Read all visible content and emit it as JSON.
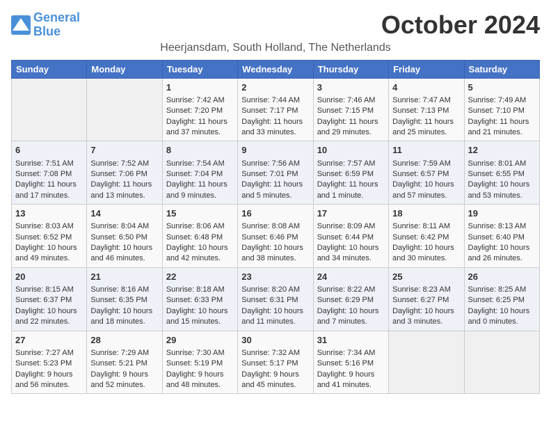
{
  "logo": {
    "line1": "General",
    "line2": "Blue"
  },
  "title": "October 2024",
  "location": "Heerjansdam, South Holland, The Netherlands",
  "days_header": [
    "Sunday",
    "Monday",
    "Tuesday",
    "Wednesday",
    "Thursday",
    "Friday",
    "Saturday"
  ],
  "weeks": [
    [
      {
        "day": "",
        "lines": []
      },
      {
        "day": "",
        "lines": []
      },
      {
        "day": "1",
        "lines": [
          "Sunrise: 7:42 AM",
          "Sunset: 7:20 PM",
          "Daylight: 11 hours and 37 minutes."
        ]
      },
      {
        "day": "2",
        "lines": [
          "Sunrise: 7:44 AM",
          "Sunset: 7:17 PM",
          "Daylight: 11 hours and 33 minutes."
        ]
      },
      {
        "day": "3",
        "lines": [
          "Sunrise: 7:46 AM",
          "Sunset: 7:15 PM",
          "Daylight: 11 hours and 29 minutes."
        ]
      },
      {
        "day": "4",
        "lines": [
          "Sunrise: 7:47 AM",
          "Sunset: 7:13 PM",
          "Daylight: 11 hours and 25 minutes."
        ]
      },
      {
        "day": "5",
        "lines": [
          "Sunrise: 7:49 AM",
          "Sunset: 7:10 PM",
          "Daylight: 11 hours and 21 minutes."
        ]
      }
    ],
    [
      {
        "day": "6",
        "lines": [
          "Sunrise: 7:51 AM",
          "Sunset: 7:08 PM",
          "Daylight: 11 hours and 17 minutes."
        ]
      },
      {
        "day": "7",
        "lines": [
          "Sunrise: 7:52 AM",
          "Sunset: 7:06 PM",
          "Daylight: 11 hours and 13 minutes."
        ]
      },
      {
        "day": "8",
        "lines": [
          "Sunrise: 7:54 AM",
          "Sunset: 7:04 PM",
          "Daylight: 11 hours and 9 minutes."
        ]
      },
      {
        "day": "9",
        "lines": [
          "Sunrise: 7:56 AM",
          "Sunset: 7:01 PM",
          "Daylight: 11 hours and 5 minutes."
        ]
      },
      {
        "day": "10",
        "lines": [
          "Sunrise: 7:57 AM",
          "Sunset: 6:59 PM",
          "Daylight: 11 hours and 1 minute."
        ]
      },
      {
        "day": "11",
        "lines": [
          "Sunrise: 7:59 AM",
          "Sunset: 6:57 PM",
          "Daylight: 10 hours and 57 minutes."
        ]
      },
      {
        "day": "12",
        "lines": [
          "Sunrise: 8:01 AM",
          "Sunset: 6:55 PM",
          "Daylight: 10 hours and 53 minutes."
        ]
      }
    ],
    [
      {
        "day": "13",
        "lines": [
          "Sunrise: 8:03 AM",
          "Sunset: 6:52 PM",
          "Daylight: 10 hours and 49 minutes."
        ]
      },
      {
        "day": "14",
        "lines": [
          "Sunrise: 8:04 AM",
          "Sunset: 6:50 PM",
          "Daylight: 10 hours and 46 minutes."
        ]
      },
      {
        "day": "15",
        "lines": [
          "Sunrise: 8:06 AM",
          "Sunset: 6:48 PM",
          "Daylight: 10 hours and 42 minutes."
        ]
      },
      {
        "day": "16",
        "lines": [
          "Sunrise: 8:08 AM",
          "Sunset: 6:46 PM",
          "Daylight: 10 hours and 38 minutes."
        ]
      },
      {
        "day": "17",
        "lines": [
          "Sunrise: 8:09 AM",
          "Sunset: 6:44 PM",
          "Daylight: 10 hours and 34 minutes."
        ]
      },
      {
        "day": "18",
        "lines": [
          "Sunrise: 8:11 AM",
          "Sunset: 6:42 PM",
          "Daylight: 10 hours and 30 minutes."
        ]
      },
      {
        "day": "19",
        "lines": [
          "Sunrise: 8:13 AM",
          "Sunset: 6:40 PM",
          "Daylight: 10 hours and 26 minutes."
        ]
      }
    ],
    [
      {
        "day": "20",
        "lines": [
          "Sunrise: 8:15 AM",
          "Sunset: 6:37 PM",
          "Daylight: 10 hours and 22 minutes."
        ]
      },
      {
        "day": "21",
        "lines": [
          "Sunrise: 8:16 AM",
          "Sunset: 6:35 PM",
          "Daylight: 10 hours and 18 minutes."
        ]
      },
      {
        "day": "22",
        "lines": [
          "Sunrise: 8:18 AM",
          "Sunset: 6:33 PM",
          "Daylight: 10 hours and 15 minutes."
        ]
      },
      {
        "day": "23",
        "lines": [
          "Sunrise: 8:20 AM",
          "Sunset: 6:31 PM",
          "Daylight: 10 hours and 11 minutes."
        ]
      },
      {
        "day": "24",
        "lines": [
          "Sunrise: 8:22 AM",
          "Sunset: 6:29 PM",
          "Daylight: 10 hours and 7 minutes."
        ]
      },
      {
        "day": "25",
        "lines": [
          "Sunrise: 8:23 AM",
          "Sunset: 6:27 PM",
          "Daylight: 10 hours and 3 minutes."
        ]
      },
      {
        "day": "26",
        "lines": [
          "Sunrise: 8:25 AM",
          "Sunset: 6:25 PM",
          "Daylight: 10 hours and 0 minutes."
        ]
      }
    ],
    [
      {
        "day": "27",
        "lines": [
          "Sunrise: 7:27 AM",
          "Sunset: 5:23 PM",
          "Daylight: 9 hours and 56 minutes."
        ]
      },
      {
        "day": "28",
        "lines": [
          "Sunrise: 7:29 AM",
          "Sunset: 5:21 PM",
          "Daylight: 9 hours and 52 minutes."
        ]
      },
      {
        "day": "29",
        "lines": [
          "Sunrise: 7:30 AM",
          "Sunset: 5:19 PM",
          "Daylight: 9 hours and 48 minutes."
        ]
      },
      {
        "day": "30",
        "lines": [
          "Sunrise: 7:32 AM",
          "Sunset: 5:17 PM",
          "Daylight: 9 hours and 45 minutes."
        ]
      },
      {
        "day": "31",
        "lines": [
          "Sunrise: 7:34 AM",
          "Sunset: 5:16 PM",
          "Daylight: 9 hours and 41 minutes."
        ]
      },
      {
        "day": "",
        "lines": []
      },
      {
        "day": "",
        "lines": []
      }
    ]
  ]
}
